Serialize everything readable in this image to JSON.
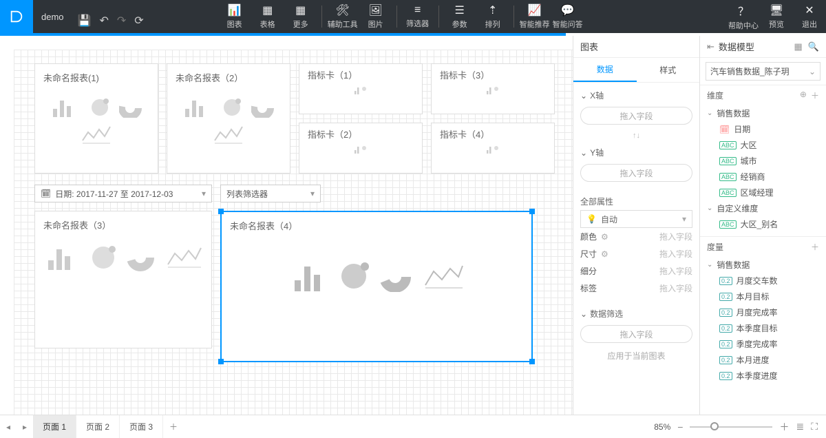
{
  "header": {
    "title": "demo",
    "tools": {
      "chart": "图表",
      "table": "表格",
      "more": "更多",
      "aux": "辅助工具",
      "image": "图片",
      "filter": "筛选器",
      "param": "参数",
      "sort": "排列",
      "smart_rec": "智能推荐",
      "smart_qa": "智能问答",
      "help": "帮助中心",
      "preview": "预览",
      "exit": "退出"
    }
  },
  "canvas": {
    "widgets": {
      "w1": "未命名报表(1)",
      "w2": "未命名报表（2）",
      "ind1": "指标卡（1）",
      "ind2": "指标卡（2）",
      "ind3": "指标卡（3）",
      "ind4": "指标卡（4）",
      "w3": "未命名报表（3）",
      "w4": "未命名报表（4）"
    },
    "filters": {
      "date_label": "日期: 2017-11-27 至 2017-12-03",
      "list_filter": "列表筛选器"
    }
  },
  "right_panel": {
    "title": "图表",
    "tabs": {
      "data": "数据",
      "style": "样式"
    },
    "x_axis": "X轴",
    "y_axis": "Y轴",
    "drop_placeholder": "拖入字段",
    "all_attrs": "全部属性",
    "auto": "自动",
    "attrs": {
      "color": "颜色",
      "size": "尺寸",
      "detail": "细分",
      "label": "标签"
    },
    "attr_placeholder": "拖入字段",
    "data_filter": "数据筛选",
    "apply_current": "应用于当前图表"
  },
  "data_model": {
    "title": "数据模型",
    "source": "汽车销售数据_陈子玥",
    "dim_label": "维度",
    "dim_group": "销售数据",
    "dims": {
      "date": "日期",
      "region": "大区",
      "city": "城市",
      "dealer": "经销商",
      "area_mgr": "区域经理"
    },
    "custom_dim_label": "自定义维度",
    "custom_dims": {
      "region_alias": "大区_别名"
    },
    "measure_label": "度量",
    "measure_group": "销售数据",
    "measures": {
      "m1": "月度交车数",
      "m2": "本月目标",
      "m3": "月度完成率",
      "m4": "本季度目标",
      "m5": "季度完成率",
      "m6": "本月进度",
      "m7": "本季度进度"
    }
  },
  "bottom": {
    "pages": {
      "p1": "页面 1",
      "p2": "页面 2",
      "p3": "页面 3"
    },
    "zoom_pct": "85%"
  }
}
